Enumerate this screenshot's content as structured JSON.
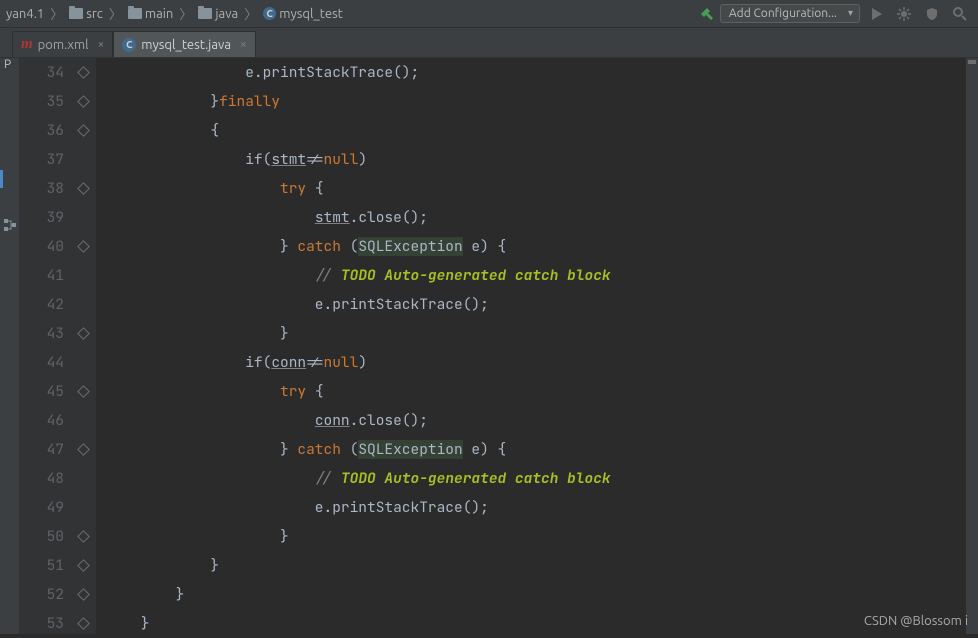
{
  "breadcrumbs": {
    "project": "yan4.1",
    "parts": [
      "src",
      "main",
      "java"
    ],
    "file": "mysql_test",
    "file_prefix": "C"
  },
  "run_config_label": "Add Configuration...",
  "tabs": [
    {
      "icon": "m",
      "label": "pom.xml",
      "active": false
    },
    {
      "icon": "c",
      "label": "mysql_test.java",
      "active": true
    }
  ],
  "project_letter": "P",
  "line_numbers": [
    "34",
    "35",
    "36",
    "37",
    "38",
    "39",
    "40",
    "41",
    "42",
    "43",
    "44",
    "45",
    "46",
    "47",
    "48",
    "49",
    "50",
    "51",
    "52",
    "53"
  ],
  "code": {
    "l34": "                e.printStackTrace();",
    "l35a": "            }",
    "l35b": "finally",
    "l36": "            {",
    "l37a": "                if(",
    "l37b": "stmt",
    "l37c": "!=",
    "l37d": "null",
    "l37e": ")",
    "l38a": "                    ",
    "l38b": "try ",
    "l38c": "{",
    "l39a": "                        ",
    "l39b": "stmt",
    "l39c": ".close();",
    "l40a": "                    } ",
    "l40b": "catch ",
    "l40c": "(",
    "l40d": "SQLException",
    "l40e": " e) {",
    "l41a": "                        ",
    "l41b": "// ",
    "l41c": "TODO Auto-generated catch block",
    "l42": "                        e.printStackTrace();",
    "l43": "                    }",
    "l44a": "                if(",
    "l44b": "conn",
    "l44c": "!=",
    "l44d": "null",
    "l44e": ")",
    "l45a": "                    ",
    "l45b": "try ",
    "l45c": "{",
    "l46a": "                        ",
    "l46b": "conn",
    "l46c": ".close();",
    "l47a": "                    } ",
    "l47b": "catch ",
    "l47c": "(",
    "l47d": "SQLException",
    "l47e": " e) {",
    "l48a": "                        ",
    "l48b": "// ",
    "l48c": "TODO Auto-generated catch block",
    "l49": "                        e.printStackTrace();",
    "l50": "                    }",
    "l51": "            }",
    "l52": "        }",
    "l53": "    }"
  },
  "watermark": "CSDN @Blossom i"
}
